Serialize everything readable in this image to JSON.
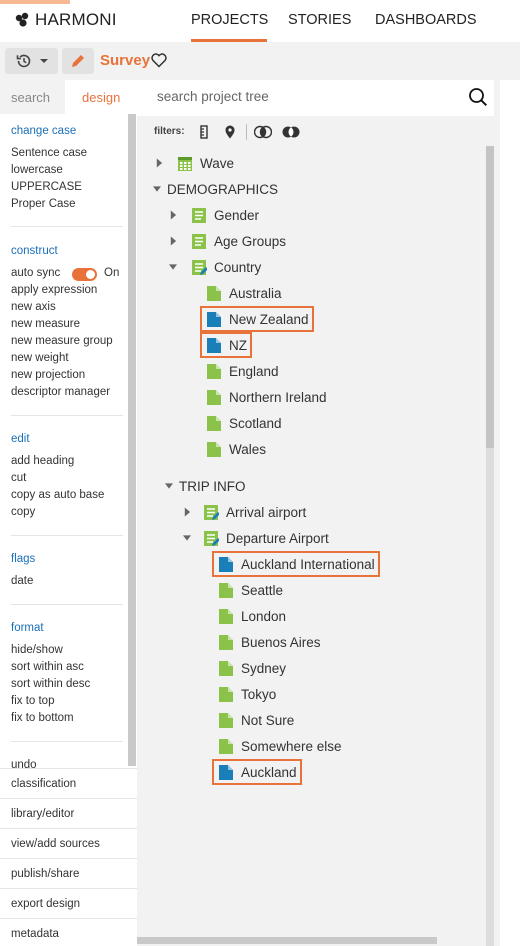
{
  "header": {
    "brand": "HARMONI",
    "tabs": [
      "PROJECTS",
      "STORIES",
      "DASHBOARDS"
    ]
  },
  "toolbar": {
    "title": "Survey"
  },
  "left_panel": {
    "tabs": {
      "search": "search",
      "design": "design"
    },
    "sections": [
      {
        "title": "change case",
        "items": [
          "Sentence case",
          "lowercase",
          "UPPERCASE",
          "Proper Case"
        ]
      },
      {
        "title": "construct",
        "items": [
          "auto sync",
          "apply expression",
          "new axis",
          "new measure",
          "new measure group",
          "new weight",
          "new projection",
          "descriptor manager"
        ]
      },
      {
        "title": "edit",
        "items": [
          "add heading",
          "cut",
          "copy as auto base",
          "copy"
        ]
      },
      {
        "title": "flags",
        "items": [
          "date"
        ]
      },
      {
        "title": "format",
        "items": [
          "hide/show",
          "sort within asc",
          "sort within desc",
          "fix to top",
          "fix to bottom"
        ]
      }
    ],
    "auto_sync_state": "On",
    "cut_off_item": "undo",
    "bottom_menu": [
      "classification",
      "library/editor",
      "view/add sources",
      "publish/share",
      "export design",
      "metadata"
    ]
  },
  "right_panel": {
    "search_placeholder": "search project tree",
    "filters_label": "filters:"
  },
  "tree": [
    {
      "label": "Wave",
      "level": 1,
      "icon": "calendar-icon",
      "caret": "right"
    },
    {
      "label": "DEMOGRAPHICS",
      "level": 0,
      "icon": "",
      "caret": "down"
    },
    {
      "label": "Gender",
      "level": 2,
      "icon": "variable-icon",
      "caret": "right"
    },
    {
      "label": "Age Groups",
      "level": 2,
      "icon": "variable-icon",
      "caret": "right"
    },
    {
      "label": "Country",
      "level": 2,
      "icon": "edited-variable-icon",
      "caret": "down"
    },
    {
      "label": "Australia",
      "level": 3,
      "icon": "green-code-icon",
      "caret": ""
    },
    {
      "label": "New Zealand",
      "level": 3,
      "icon": "blue-code-icon",
      "caret": "",
      "highlight": true
    },
    {
      "label": "NZ",
      "level": 3,
      "icon": "blue-code-icon",
      "caret": "",
      "highlight": true
    },
    {
      "label": "England",
      "level": 3,
      "icon": "green-code-icon",
      "caret": ""
    },
    {
      "label": "Northern Ireland",
      "level": 3,
      "icon": "green-code-icon",
      "caret": ""
    },
    {
      "label": "Scotland",
      "level": 3,
      "icon": "green-code-icon",
      "caret": ""
    },
    {
      "label": "Wales",
      "level": 3,
      "icon": "green-code-icon",
      "caret": ""
    },
    {
      "label": "TRIP INFO",
      "level": 0,
      "icon": "",
      "caret": "down"
    },
    {
      "label": "Arrival airport",
      "level": 2,
      "icon": "edited-variable-icon",
      "caret": "right"
    },
    {
      "label": "Departure Airport",
      "level": 2,
      "icon": "edited-variable-icon",
      "caret": "down"
    },
    {
      "label": "Auckland International",
      "level": 3,
      "icon": "blue-code-icon",
      "caret": "",
      "highlight": true
    },
    {
      "label": "Seattle",
      "level": 3,
      "icon": "green-code-icon",
      "caret": ""
    },
    {
      "label": "London",
      "level": 3,
      "icon": "green-code-icon",
      "caret": ""
    },
    {
      "label": "Buenos Aires",
      "level": 3,
      "icon": "green-code-icon",
      "caret": ""
    },
    {
      "label": "Sydney",
      "level": 3,
      "icon": "green-code-icon",
      "caret": ""
    },
    {
      "label": "Tokyo",
      "level": 3,
      "icon": "green-code-icon",
      "caret": ""
    },
    {
      "label": "Not Sure",
      "level": 3,
      "icon": "green-code-icon",
      "caret": ""
    },
    {
      "label": "Somewhere else",
      "level": 3,
      "icon": "green-code-icon",
      "caret": ""
    },
    {
      "label": "Auckland",
      "level": 3,
      "icon": "blue-code-icon",
      "caret": "",
      "highlight": true
    }
  ],
  "colors": {
    "accent": "#e8733a",
    "link": "#1a6fb8",
    "green_code": "#8bc34a",
    "blue_code": "#1a7fb8"
  }
}
